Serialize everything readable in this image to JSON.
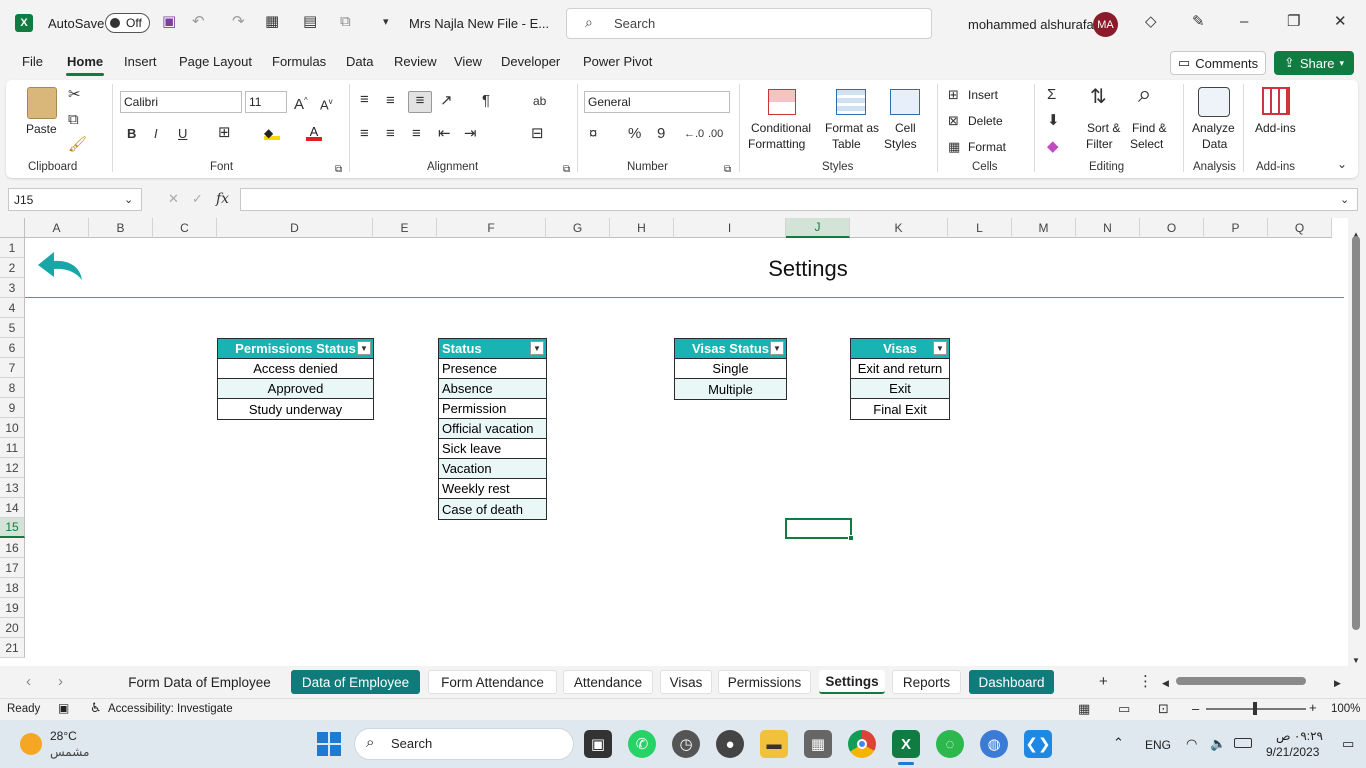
{
  "titlebar": {
    "autosave_label": "AutoSave",
    "autosave_state": "Off",
    "file_name": "Mrs Najla New File  -  E...",
    "search_placeholder": "Search",
    "user_name": "mohammed alshurafa",
    "user_initials": "MA"
  },
  "menu": {
    "items": [
      "File",
      "Home",
      "Insert",
      "Page Layout",
      "Formulas",
      "Data",
      "Review",
      "View",
      "Developer",
      "Power Pivot"
    ],
    "active": "Home",
    "comments_label": "Comments",
    "share_label": "Share"
  },
  "ribbon": {
    "clipboard": {
      "paste": "Paste",
      "group": "Clipboard"
    },
    "font": {
      "name": "Calibri",
      "size": "11",
      "group": "Font",
      "bold": "B",
      "italic": "I",
      "underline": "U"
    },
    "alignment": {
      "group": "Alignment"
    },
    "number": {
      "format": "General",
      "group": "Number"
    },
    "styles": {
      "conditional_1": "Conditional",
      "conditional_2": "Formatting",
      "format_table_1": "Format as",
      "format_table_2": "Table",
      "cell_styles_1": "Cell",
      "cell_styles_2": "Styles",
      "group": "Styles"
    },
    "cells": {
      "insert": "Insert",
      "delete": "Delete",
      "format": "Format",
      "group": "Cells"
    },
    "editing": {
      "sort_1": "Sort &",
      "sort_2": "Filter",
      "find_1": "Find &",
      "find_2": "Select",
      "group": "Editing"
    },
    "analysis": {
      "analyze_1": "Analyze",
      "analyze_2": "Data",
      "group": "Analysis"
    },
    "addins": {
      "label": "Add-ins",
      "group": "Add-ins"
    }
  },
  "formula_bar": {
    "name_box": "J15",
    "fx": "fx",
    "value": ""
  },
  "grid": {
    "columns": [
      "A",
      "B",
      "C",
      "D",
      "E",
      "F",
      "G",
      "H",
      "I",
      "J",
      "K",
      "L",
      "M",
      "N",
      "O",
      "P",
      "Q"
    ],
    "rows": [
      "1",
      "2",
      "3",
      "4",
      "5",
      "6",
      "7",
      "8",
      "9",
      "10",
      "11",
      "12",
      "13",
      "14",
      "15",
      "16",
      "17",
      "18",
      "19",
      "20",
      "21"
    ],
    "selected_column": "J",
    "selected_row": "15"
  },
  "sheet": {
    "title": "Settings",
    "tables": [
      {
        "header": "Permissions Status",
        "rows": [
          "Access denied",
          "Approved",
          "Study underway"
        ]
      },
      {
        "header": "Status",
        "rows": [
          "Presence",
          "Absence",
          "Permission",
          "Official vacation",
          "Sick leave",
          "Vacation",
          "Weekly rest",
          "Case of death"
        ]
      },
      {
        "header": "Visas Status",
        "rows": [
          "Single",
          "Multiple"
        ]
      },
      {
        "header": "Visas",
        "rows": [
          "Exit and return",
          "Exit",
          "Final Exit"
        ]
      }
    ]
  },
  "tabs": [
    "Form Data of Employee",
    "Data of Employee",
    "Form Attendance",
    "Attendance",
    "Visas",
    "Permissions",
    "Settings",
    "Reports",
    "Dashboard"
  ],
  "active_tab": "Settings",
  "status": {
    "ready": "Ready",
    "accessibility": "Accessibility: Investigate",
    "zoom": "100%"
  },
  "taskbar": {
    "weather_temp": "28°C",
    "weather_desc": "مشمس",
    "search_label": "Search",
    "lang": "ENG",
    "time": "٠٩:٢٩ ص",
    "date": "9/21/2023"
  },
  "colors": {
    "accent": "#107c41",
    "teal": "#19b3b3",
    "tab_dark": "#0f7b7b"
  }
}
